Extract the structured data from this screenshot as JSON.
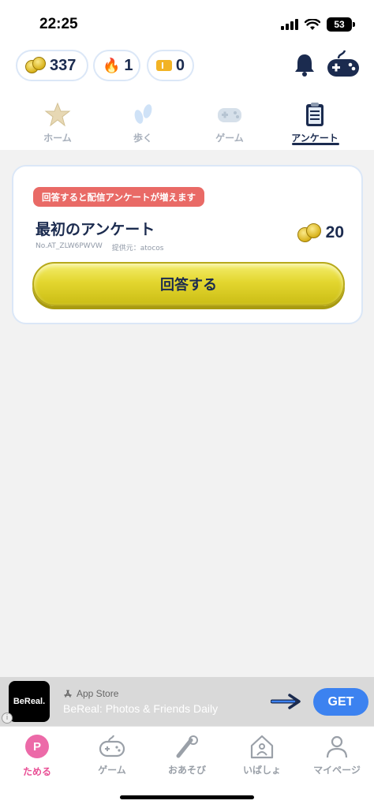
{
  "status_bar": {
    "time": "22:25",
    "battery": "53"
  },
  "currencies": {
    "coins": "337",
    "fire": "1",
    "tickets": "0"
  },
  "tabs": [
    {
      "label": "ホーム",
      "icon": "star-icon"
    },
    {
      "label": "歩く",
      "icon": "footprints-icon"
    },
    {
      "label": "ゲーム",
      "icon": "gamepad-icon"
    },
    {
      "label": "アンケート",
      "icon": "clipboard-icon",
      "active": true
    }
  ],
  "survey": {
    "badge": "回答すると配信アンケートが増えます",
    "title": "最初のアンケート",
    "id": "No.AT_ZLW6PWVW",
    "provider": "提供元：atocos",
    "reward": "20",
    "answer_label": "回答する"
  },
  "ad": {
    "logo": "BeReal.",
    "store": "App Store",
    "app_name": "BeReal: Photos & Friends Daily",
    "cta": "GET"
  },
  "bottom_nav": [
    {
      "label": "ためる",
      "icon": "p-coin-icon",
      "active": true
    },
    {
      "label": "ゲーム",
      "icon": "gamepad-icon"
    },
    {
      "label": "おあそび",
      "icon": "baseball-icon"
    },
    {
      "label": "いばしょ",
      "icon": "house-icon"
    },
    {
      "label": "マイページ",
      "icon": "person-icon"
    }
  ],
  "colors": {
    "accent_navy": "#1b2b4f",
    "badge_red": "#e96a66",
    "button_yellow": "#e3d62f",
    "active_pink": "#e94f95",
    "get_blue": "#3c82f0"
  }
}
